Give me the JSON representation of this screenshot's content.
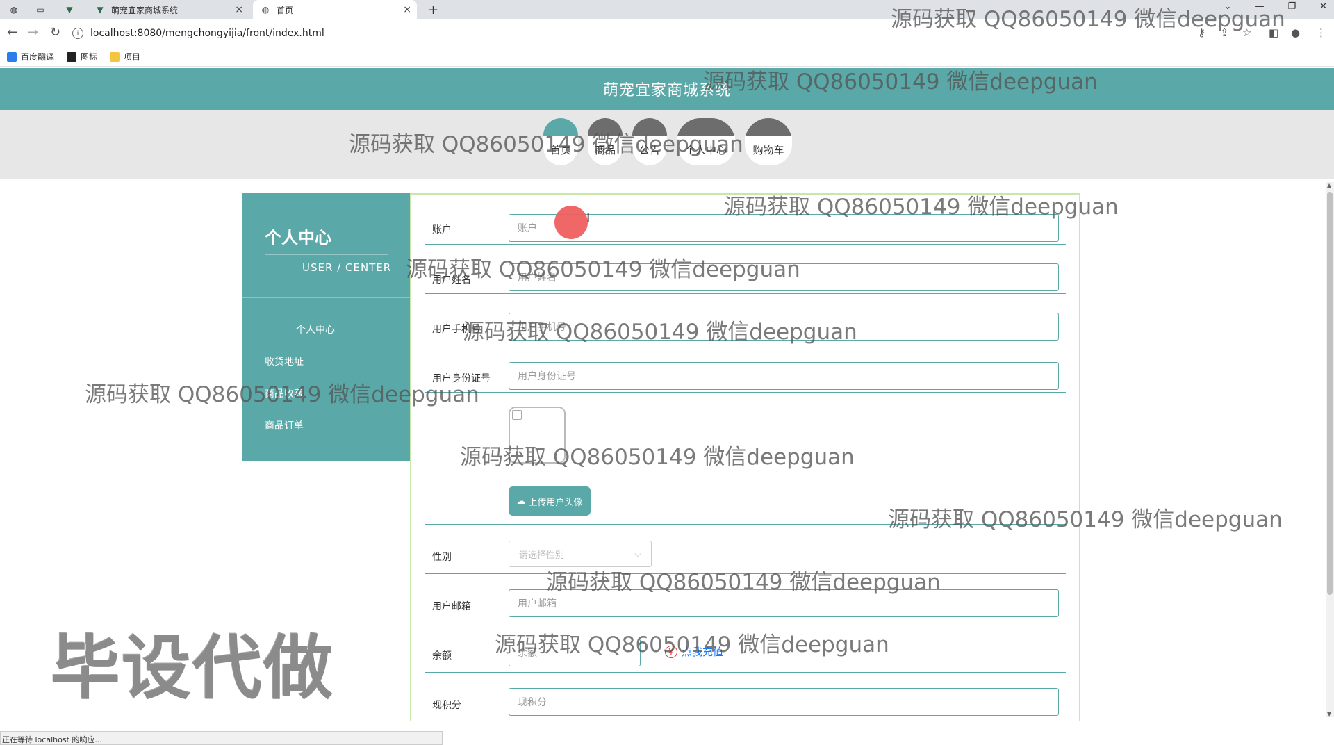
{
  "browser": {
    "tabs": [
      {
        "label": "萌宠宜家商城系统",
        "icon": "vue-icon"
      },
      {
        "label": "首页",
        "icon": "globe-icon"
      }
    ],
    "new_tab": "+",
    "url": "localhost:8080/mengchongyijia/front/index.html",
    "bookmarks": [
      "百度翻译",
      "图标",
      "项目"
    ],
    "status": "正在等待 localhost 的响应..."
  },
  "site": {
    "title": "萌宠宜家商城系统",
    "nav": [
      "首页",
      "商品",
      "公告",
      "个人中心",
      "购物车"
    ],
    "active_nav": "首页"
  },
  "sidebar": {
    "title": "个人中心",
    "subtitle": "USER / CENTER",
    "items": [
      "个人中心",
      "收货地址",
      "商品收藏",
      "商品订单"
    ]
  },
  "form": {
    "account": {
      "label": "账户",
      "placeholder": "账户"
    },
    "name": {
      "label": "用户姓名",
      "placeholder": "用户姓名"
    },
    "phone": {
      "label": "用户手机号",
      "placeholder": "用户手机号"
    },
    "idcard": {
      "label": "用户身份证号",
      "placeholder": "用户身份证号"
    },
    "upload_label": "上传用户头像",
    "gender": {
      "label": "性别",
      "placeholder": "请选择性别"
    },
    "email": {
      "label": "用户邮箱",
      "placeholder": "用户邮箱"
    },
    "balance": {
      "label": "余额",
      "placeholder": "余额",
      "action": "点我充值",
      "action_icon": "¥"
    },
    "points": {
      "label": "现积分",
      "placeholder": "现积分"
    }
  },
  "watermarks": {
    "text": "源码获取 QQ86050149 微信deepguan",
    "big": "毕设代做"
  },
  "colors": {
    "primary": "#5aa9a8",
    "form_border": "#c8e7a8",
    "link": "#1677ff",
    "cursor": "#ef5f5f"
  }
}
